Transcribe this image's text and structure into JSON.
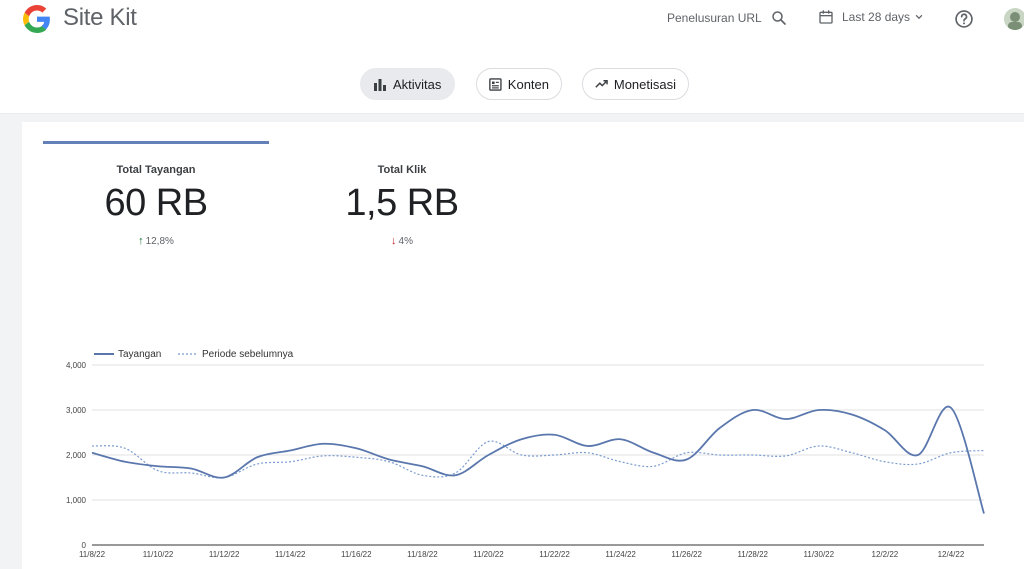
{
  "header": {
    "brand": "Site Kit",
    "search_label": "Penelusuran URL",
    "date_range_label": "Last 28 days",
    "icons": [
      "google-logo",
      "search-icon",
      "calendar-icon",
      "chevron-down-icon",
      "help-icon",
      "avatar"
    ]
  },
  "tabs": [
    {
      "label": "Aktivitas",
      "icon": "bar-chart-icon",
      "active": true
    },
    {
      "label": "Konten",
      "icon": "article-icon",
      "active": false
    },
    {
      "label": "Monetisasi",
      "icon": "trending-up-icon",
      "active": false
    }
  ],
  "metrics": [
    {
      "label": "Total Tayangan",
      "value": "60 RB",
      "change": "12,8%",
      "direction": "up"
    },
    {
      "label": "Total Klik",
      "value": "1,5 RB",
      "change": "4%",
      "direction": "down"
    }
  ],
  "colors": {
    "accent": "#6380b8",
    "series": "#5a77ad",
    "previous": "#7a9bd0",
    "up": "#137333",
    "down": "#c5221f"
  },
  "chart_data": {
    "type": "line",
    "legend": {
      "position": "top-left",
      "entries": [
        "Tayangan",
        "Periode sebelumnya"
      ]
    },
    "x_ticks": [
      "11/8/22",
      "11/10/22",
      "11/12/22",
      "11/14/22",
      "11/16/22",
      "11/18/22",
      "11/20/22",
      "11/22/22",
      "11/24/22",
      "11/26/22",
      "11/28/22",
      "11/30/22",
      "12/2/22",
      "12/4/22"
    ],
    "y_ticks": [
      "0",
      "1,000",
      "2,000",
      "3,000",
      "4,000"
    ],
    "ylim": [
      0,
      4000
    ],
    "grid": true,
    "series": [
      {
        "name": "Tayangan",
        "style": "solid",
        "points": [
          [
            "11/8/22",
            2050
          ],
          [
            "11/9/22",
            1850
          ],
          [
            "11/10/22",
            1750
          ],
          [
            "11/11/22",
            1700
          ],
          [
            "11/12/22",
            1500
          ],
          [
            "11/13/22",
            1950
          ],
          [
            "11/14/22",
            2100
          ],
          [
            "11/15/22",
            2250
          ],
          [
            "11/16/22",
            2150
          ],
          [
            "11/17/22",
            1900
          ],
          [
            "11/18/22",
            1750
          ],
          [
            "11/19/22",
            1550
          ],
          [
            "11/20/22",
            2000
          ],
          [
            "11/21/22",
            2350
          ],
          [
            "11/22/22",
            2450
          ],
          [
            "11/23/22",
            2200
          ],
          [
            "11/24/22",
            2350
          ],
          [
            "11/25/22",
            2050
          ],
          [
            "11/26/22",
            1900
          ],
          [
            "11/27/22",
            2600
          ],
          [
            "11/28/22",
            3000
          ],
          [
            "11/29/22",
            2800
          ],
          [
            "11/30/22",
            3000
          ],
          [
            "12/1/22",
            2900
          ],
          [
            "12/2/22",
            2550
          ],
          [
            "12/3/22",
            2000
          ],
          [
            "12/4/22",
            3050
          ],
          [
            "12/5/22",
            700
          ]
        ]
      },
      {
        "name": "Periode sebelumnya",
        "style": "dotted",
        "points": [
          [
            "11/8/22",
            2200
          ],
          [
            "11/9/22",
            2150
          ],
          [
            "11/10/22",
            1650
          ],
          [
            "11/11/22",
            1600
          ],
          [
            "11/12/22",
            1500
          ],
          [
            "11/13/22",
            1800
          ],
          [
            "11/14/22",
            1850
          ],
          [
            "11/15/22",
            1980
          ],
          [
            "11/16/22",
            1950
          ],
          [
            "11/17/22",
            1850
          ],
          [
            "11/18/22",
            1550
          ],
          [
            "11/19/22",
            1600
          ],
          [
            "11/20/22",
            2300
          ],
          [
            "11/21/22",
            2000
          ],
          [
            "11/22/22",
            2000
          ],
          [
            "11/23/22",
            2050
          ],
          [
            "11/24/22",
            1850
          ],
          [
            "11/25/22",
            1750
          ],
          [
            "11/26/22",
            2050
          ],
          [
            "11/27/22",
            2000
          ],
          [
            "11/28/22",
            2000
          ],
          [
            "11/29/22",
            1980
          ],
          [
            "11/30/22",
            2200
          ],
          [
            "12/1/22",
            2050
          ],
          [
            "12/2/22",
            1850
          ],
          [
            "12/3/22",
            1800
          ],
          [
            "12/4/22",
            2050
          ],
          [
            "12/5/22",
            2100
          ]
        ]
      }
    ]
  }
}
